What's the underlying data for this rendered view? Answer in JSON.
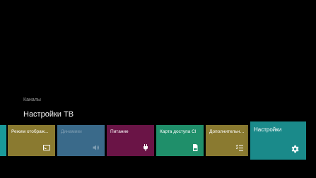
{
  "header": {
    "breadcrumb": "Каналы",
    "title": "Настройки ТВ"
  },
  "tiles": [
    {
      "label": "",
      "icon": "none",
      "color": "#1a9a9a",
      "enabled": true
    },
    {
      "label": "Режим отображ...",
      "icon": "aspect-ratio-icon",
      "color": "#8a7a30",
      "enabled": true
    },
    {
      "label": "Динамики",
      "icon": "speaker-icon",
      "color": "#3a6a8a",
      "enabled": false
    },
    {
      "label": "Питание",
      "icon": "power-plug-icon",
      "color": "#6a1446",
      "enabled": true
    },
    {
      "label": "Карта доступа CI",
      "icon": "sd-card-icon",
      "color": "#1f8f6a",
      "enabled": true
    },
    {
      "label": "Дополнительны...",
      "icon": "checklist-icon",
      "color": "#8a7a30",
      "enabled": true
    },
    {
      "label": "Настройки",
      "icon": "gear-icon",
      "color": "#1a8a8a",
      "enabled": true,
      "selected": true
    }
  ]
}
